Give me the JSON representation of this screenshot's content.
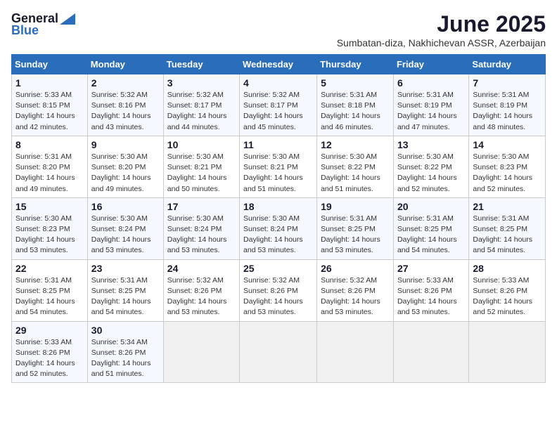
{
  "logo": {
    "line1": "General",
    "line2": "Blue"
  },
  "title": "June 2025",
  "subtitle": "Sumbatan-diza, Nakhichevan ASSR, Azerbaijan",
  "headers": [
    "Sunday",
    "Monday",
    "Tuesday",
    "Wednesday",
    "Thursday",
    "Friday",
    "Saturday"
  ],
  "weeks": [
    [
      {
        "day": "1",
        "info": "Sunrise: 5:33 AM\nSunset: 8:15 PM\nDaylight: 14 hours\nand 42 minutes."
      },
      {
        "day": "2",
        "info": "Sunrise: 5:32 AM\nSunset: 8:16 PM\nDaylight: 14 hours\nand 43 minutes."
      },
      {
        "day": "3",
        "info": "Sunrise: 5:32 AM\nSunset: 8:17 PM\nDaylight: 14 hours\nand 44 minutes."
      },
      {
        "day": "4",
        "info": "Sunrise: 5:32 AM\nSunset: 8:17 PM\nDaylight: 14 hours\nand 45 minutes."
      },
      {
        "day": "5",
        "info": "Sunrise: 5:31 AM\nSunset: 8:18 PM\nDaylight: 14 hours\nand 46 minutes."
      },
      {
        "day": "6",
        "info": "Sunrise: 5:31 AM\nSunset: 8:19 PM\nDaylight: 14 hours\nand 47 minutes."
      },
      {
        "day": "7",
        "info": "Sunrise: 5:31 AM\nSunset: 8:19 PM\nDaylight: 14 hours\nand 48 minutes."
      }
    ],
    [
      {
        "day": "8",
        "info": "Sunrise: 5:31 AM\nSunset: 8:20 PM\nDaylight: 14 hours\nand 49 minutes."
      },
      {
        "day": "9",
        "info": "Sunrise: 5:30 AM\nSunset: 8:20 PM\nDaylight: 14 hours\nand 49 minutes."
      },
      {
        "day": "10",
        "info": "Sunrise: 5:30 AM\nSunset: 8:21 PM\nDaylight: 14 hours\nand 50 minutes."
      },
      {
        "day": "11",
        "info": "Sunrise: 5:30 AM\nSunset: 8:21 PM\nDaylight: 14 hours\nand 51 minutes."
      },
      {
        "day": "12",
        "info": "Sunrise: 5:30 AM\nSunset: 8:22 PM\nDaylight: 14 hours\nand 51 minutes."
      },
      {
        "day": "13",
        "info": "Sunrise: 5:30 AM\nSunset: 8:22 PM\nDaylight: 14 hours\nand 52 minutes."
      },
      {
        "day": "14",
        "info": "Sunrise: 5:30 AM\nSunset: 8:23 PM\nDaylight: 14 hours\nand 52 minutes."
      }
    ],
    [
      {
        "day": "15",
        "info": "Sunrise: 5:30 AM\nSunset: 8:23 PM\nDaylight: 14 hours\nand 53 minutes."
      },
      {
        "day": "16",
        "info": "Sunrise: 5:30 AM\nSunset: 8:24 PM\nDaylight: 14 hours\nand 53 minutes."
      },
      {
        "day": "17",
        "info": "Sunrise: 5:30 AM\nSunset: 8:24 PM\nDaylight: 14 hours\nand 53 minutes."
      },
      {
        "day": "18",
        "info": "Sunrise: 5:30 AM\nSunset: 8:24 PM\nDaylight: 14 hours\nand 53 minutes."
      },
      {
        "day": "19",
        "info": "Sunrise: 5:31 AM\nSunset: 8:25 PM\nDaylight: 14 hours\nand 53 minutes."
      },
      {
        "day": "20",
        "info": "Sunrise: 5:31 AM\nSunset: 8:25 PM\nDaylight: 14 hours\nand 54 minutes."
      },
      {
        "day": "21",
        "info": "Sunrise: 5:31 AM\nSunset: 8:25 PM\nDaylight: 14 hours\nand 54 minutes."
      }
    ],
    [
      {
        "day": "22",
        "info": "Sunrise: 5:31 AM\nSunset: 8:25 PM\nDaylight: 14 hours\nand 54 minutes."
      },
      {
        "day": "23",
        "info": "Sunrise: 5:31 AM\nSunset: 8:25 PM\nDaylight: 14 hours\nand 54 minutes."
      },
      {
        "day": "24",
        "info": "Sunrise: 5:32 AM\nSunset: 8:26 PM\nDaylight: 14 hours\nand 53 minutes."
      },
      {
        "day": "25",
        "info": "Sunrise: 5:32 AM\nSunset: 8:26 PM\nDaylight: 14 hours\nand 53 minutes."
      },
      {
        "day": "26",
        "info": "Sunrise: 5:32 AM\nSunset: 8:26 PM\nDaylight: 14 hours\nand 53 minutes."
      },
      {
        "day": "27",
        "info": "Sunrise: 5:33 AM\nSunset: 8:26 PM\nDaylight: 14 hours\nand 53 minutes."
      },
      {
        "day": "28",
        "info": "Sunrise: 5:33 AM\nSunset: 8:26 PM\nDaylight: 14 hours\nand 52 minutes."
      }
    ],
    [
      {
        "day": "29",
        "info": "Sunrise: 5:33 AM\nSunset: 8:26 PM\nDaylight: 14 hours\nand 52 minutes."
      },
      {
        "day": "30",
        "info": "Sunrise: 5:34 AM\nSunset: 8:26 PM\nDaylight: 14 hours\nand 51 minutes."
      },
      {
        "day": "",
        "info": ""
      },
      {
        "day": "",
        "info": ""
      },
      {
        "day": "",
        "info": ""
      },
      {
        "day": "",
        "info": ""
      },
      {
        "day": "",
        "info": ""
      }
    ]
  ]
}
